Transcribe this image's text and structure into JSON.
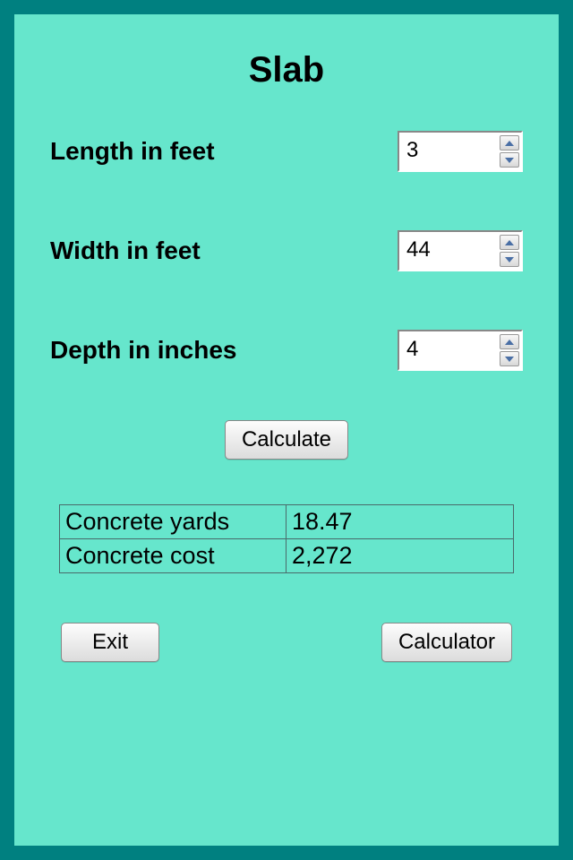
{
  "title": "Slab",
  "fields": {
    "length": {
      "label": "Length in feet",
      "value": "3"
    },
    "width": {
      "label": "Width in feet",
      "value": "44"
    },
    "depth": {
      "label": "Depth in inches",
      "value": "4"
    }
  },
  "buttons": {
    "calculate": "Calculate",
    "exit": "Exit",
    "calculator": "Calculator"
  },
  "results": {
    "yards": {
      "label": "Concrete yards",
      "value": "18.47"
    },
    "cost": {
      "label": "Concrete cost",
      "value": "2,272"
    }
  }
}
